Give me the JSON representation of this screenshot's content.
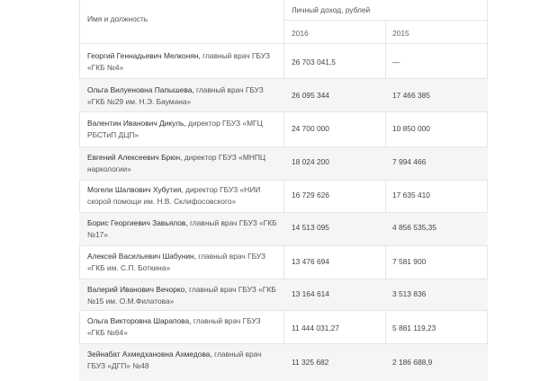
{
  "header": {
    "name_col": "Имя и должность",
    "income_col": "Личный доход, рублей",
    "year_2016": "2016",
    "year_2015": "2015"
  },
  "rows": [
    {
      "name": "Георгий Геннадьевич Мелконян,",
      "position": " главный врач ГБУЗ «ГКБ №4»",
      "y2016": "26 703 041,5",
      "y2015": "—"
    },
    {
      "name": "Ольга Вилуеновна Папышева,",
      "position": " главный врач ГБУЗ «ГКБ №29 им. Н.Э. Баумана»",
      "y2016": "26 095 344",
      "y2015": "17 466 385"
    },
    {
      "name": "Валентин Иванович Дикуль,",
      "position": " директор ГБУЗ «МГЦ РБСТиП ДЦП»",
      "y2016": "24 700 000",
      "y2015": "10 850 000"
    },
    {
      "name": "Евгений Алексеевич Брюн,",
      "position": " директор ГБУЗ «МНПЦ наркологии»",
      "y2016": "18 024 200",
      "y2015": "7 994 466"
    },
    {
      "name": "Могели Шалвович Хубутия,",
      "position": " директор ГБУЗ «НИИ скорой помощи им. Н.В. Склифосовского»",
      "y2016": "16 729 626",
      "y2015": "17 635 410"
    },
    {
      "name": "Борис Георгиевич Завьялов,",
      "position": " главный врач ГБУЗ «ГКБ №17»",
      "y2016": "14 513 095",
      "y2015": "4 856 535,35"
    },
    {
      "name": "Алексей Васильевич Шабунин,",
      "position": " главный врач ГБУЗ «ГКБ им. С.П. Боткина»",
      "y2016": "13 476 694",
      "y2015": "7 581 900"
    },
    {
      "name": "Валерий Иванович Вечорко,",
      "position": " главный врач ГБУЗ «ГКБ №15 им. О.М.Филатова»",
      "y2016": "13 164 614",
      "y2015": "3 513 836"
    },
    {
      "name": "Ольга Викторовна Шарапова,",
      "position": " главный врач ГБУЗ «ГКБ №64»",
      "y2016": "11 444 031,27",
      "y2015": "5 881 119,23"
    },
    {
      "name": "Зейнабат Ахмедхановна Ахмедова,",
      "position": " главный врач ГБУЗ «ДГП» №48",
      "y2016": "11 325 682",
      "y2015": "2 186 688,9"
    }
  ]
}
